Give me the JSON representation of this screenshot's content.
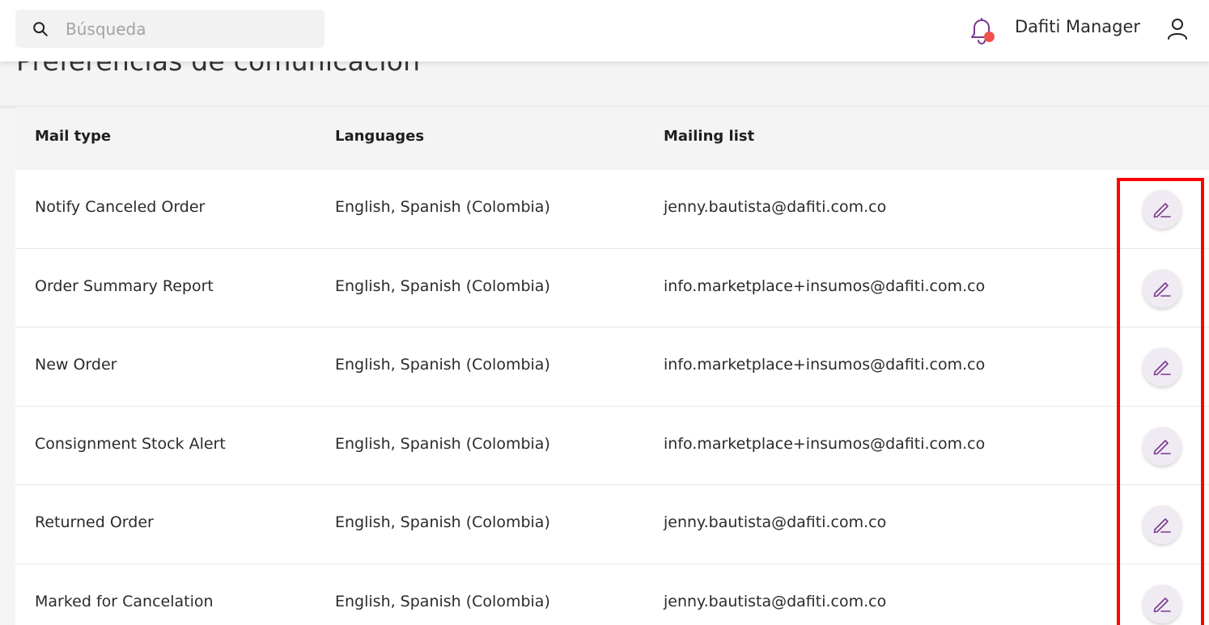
{
  "header": {
    "search_placeholder": "Búsqueda",
    "search_value": "",
    "user_name": "Dafiti Manager",
    "icons": [
      "search-icon",
      "bell-icon",
      "user-icon"
    ],
    "notification_dot_color": "#f0524f"
  },
  "page": {
    "title": "Preferencias de comunicación"
  },
  "table": {
    "columns": [
      "Mail type",
      "Languages",
      "Mailing list"
    ],
    "rows": [
      {
        "mail_type": "Notify Canceled Order",
        "languages": "English, Spanish (Colombia)",
        "mailing_list": "jenny.bautista@dafiti.com.co"
      },
      {
        "mail_type": "Order Summary Report",
        "languages": "English, Spanish (Colombia)",
        "mailing_list": "info.marketplace+insumos@dafiti.com.co"
      },
      {
        "mail_type": "New Order",
        "languages": "English, Spanish (Colombia)",
        "mailing_list": "info.marketplace+insumos@dafiti.com.co"
      },
      {
        "mail_type": "Consignment Stock Alert",
        "languages": "English, Spanish (Colombia)",
        "mailing_list": "info.marketplace+insumos@dafiti.com.co"
      },
      {
        "mail_type": "Returned Order",
        "languages": "English, Spanish (Colombia)",
        "mailing_list": "jenny.bautista@dafiti.com.co"
      },
      {
        "mail_type": "Marked for Cancelation",
        "languages": "English, Spanish (Colombia)",
        "mailing_list": "jenny.bautista@dafiti.com.co"
      }
    ],
    "row_action_icon": "pencil-icon"
  },
  "colors": {
    "accent": "#7b3a8f",
    "edit_button_bg": "#f0ebf3",
    "highlight": "#ff0000"
  }
}
